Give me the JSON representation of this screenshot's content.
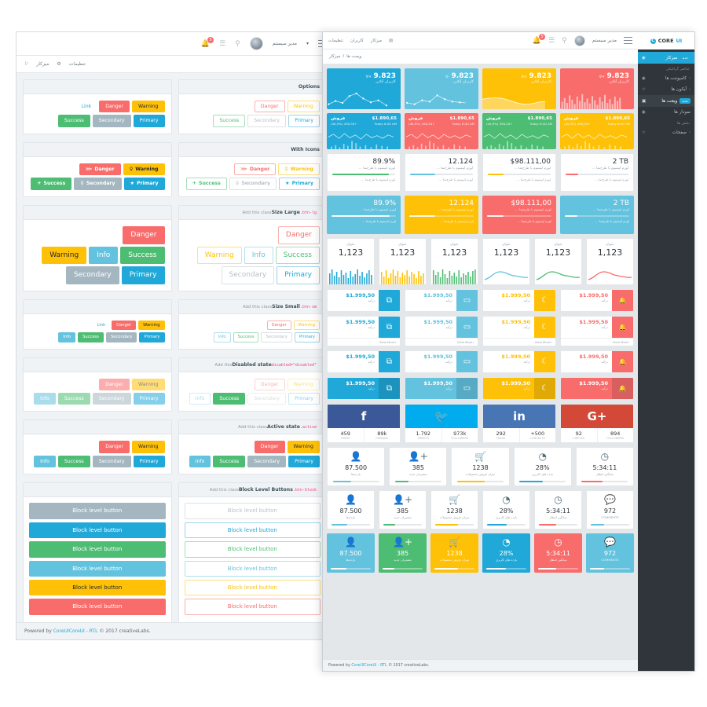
{
  "back_window": {
    "topbar": {
      "user": "مدیر سیستم",
      "caret": "▾",
      "badge_count": "5"
    },
    "breadcrumb": {
      "settings": "تنظیمات",
      "dashboard": "میزکار"
    },
    "footer": {
      "powered": "Powered by",
      "brand": "CoreUICoreUI - RTL",
      "copy": "© 2017 creativeLabs."
    },
    "sections": [
      {
        "title": "Options",
        "code": "",
        "note": "",
        "outline": [
          "Primary",
          "Secondary",
          "Success",
          "Warning",
          "Danger"
        ],
        "solid": [
          "Primary",
          "Secondary",
          "Success",
          "Warning",
          "Danger",
          "Link"
        ]
      },
      {
        "title": "With Icons",
        "code": "",
        "note": "",
        "outline": [
          "Primary",
          "Secondary",
          "Success",
          "Warning",
          "Danger"
        ],
        "solid": [
          "Primary",
          "Secondary",
          "Success",
          "Warning",
          "Danger"
        ]
      },
      {
        "title": "Size Large",
        "code": ".btn-lg",
        "note": "Add this class",
        "outline": [
          "Primary",
          "Secondary",
          "Success",
          "Info",
          "Warning",
          "Danger"
        ],
        "solid": [
          "Primary",
          "Secondary",
          "Success",
          "Info",
          "Warning",
          "Danger"
        ]
      },
      {
        "title": "Size Small",
        "code": ".btn-sm",
        "note": "Add this class",
        "outline": [
          "Primary",
          "Secondary",
          "Success",
          "Info",
          "Warning",
          "Danger"
        ],
        "solid": [
          "Primary",
          "Secondary",
          "Success",
          "Info",
          "Warning",
          "Danger",
          "Link"
        ]
      },
      {
        "title": "Disabled state",
        "code": "disabled=\"disabled\"",
        "note": "Add this",
        "outline": [
          "Primary",
          "Secondary",
          "Success",
          "Info",
          "Warning",
          "Danger"
        ],
        "solid": [
          "Primary",
          "Secondary",
          "Success",
          "Info",
          "Warning",
          "Danger"
        ]
      },
      {
        "title": "Active state",
        "code": ".active",
        "note": "Add this class",
        "outline": [
          "Primary",
          "Secondary",
          "Success",
          "Info",
          "Warning",
          "Danger"
        ],
        "solid": [
          "Primary",
          "Secondary",
          "Success",
          "Info",
          "Warning",
          "Danger"
        ]
      },
      {
        "title": "Block Level Buttons",
        "code": ".btn-block",
        "note": "Add this class",
        "block_label": "Block level button"
      }
    ],
    "icons": {
      "warning": "♀",
      "success": "✈",
      "secondary": "♀",
      "primary": "★",
      "danger": "⋙"
    }
  },
  "front_window": {
    "brand": {
      "mark": "C",
      "name_a": "CORE",
      "name_b": "UI"
    },
    "topnav": [
      "تنظیمات",
      "کاربران",
      "میزکار"
    ],
    "topbar_user": "مدیر سیستم",
    "topbar_badge": "5",
    "breadcrumb": [
      "ویجت ها",
      "/",
      "میزکار"
    ],
    "sidebar": [
      {
        "label": "میزکار",
        "icon": "◉",
        "badge": "جدید",
        "type": "item",
        "state": "active"
      },
      {
        "label": "عناصر گرافیکی",
        "type": "title"
      },
      {
        "label": "کامپوننت ها",
        "icon": "◉",
        "caret": "‹",
        "type": "item"
      },
      {
        "label": "آیکون ها",
        "icon": "☆",
        "caret": "‹",
        "type": "item"
      },
      {
        "label": "ویجت ها",
        "icon": "▣",
        "badge": "جدید",
        "type": "item",
        "state": "sel"
      },
      {
        "label": "نمودار ها",
        "icon": "◉",
        "type": "item"
      },
      {
        "label": "بخش ها",
        "type": "title"
      },
      {
        "label": "صفحات",
        "icon": "☆",
        "caret": "‹",
        "type": "item"
      }
    ],
    "row_online": {
      "value": "9.823",
      "caret": "▾",
      "gear": "⚙",
      "label": "کاربران آنلاین",
      "cards": [
        {
          "color": "#20a8d8",
          "chart": "line"
        },
        {
          "color": "#63c2de",
          "chart": "line"
        },
        {
          "color": "#ffc107",
          "chart": "area"
        },
        {
          "color": "#f86c6b",
          "chart": "bars"
        }
      ]
    },
    "row_sales": {
      "amount": "$1.890,65",
      "label": "فروش",
      "delta": "(40,9%) 490,50+",
      "time": "Today 6:40 AM",
      "cards": [
        {
          "color": "#20a8d8"
        },
        {
          "color": "#f86c6b"
        },
        {
          "color": "#4dbd74"
        },
        {
          "color": "#ffc107"
        }
      ]
    },
    "row_stats": {
      "desc": "لورم ایپسوم یا طرح‌نما …",
      "footer": "لورم ایپسوم یا طرح‌نما …",
      "cards": [
        {
          "value": "89.9%",
          "color": "#4dbd74",
          "pct": 90
        },
        {
          "value": "12.124",
          "color": "#63c2de",
          "pct": 40
        },
        {
          "value": "$98.111,00",
          "color": "#ffc107",
          "pct": 25
        },
        {
          "value": "2 TB",
          "color": "#f86c6b",
          "pct": 20
        }
      ]
    },
    "row_stats_colored": {
      "desc": "لورم ایپسوم یا طرح‌نما …",
      "footer": "لورم ایپسوم یا طرح‌نما …",
      "cards": [
        {
          "value": "89.9%",
          "color": "#63c2de",
          "pct": 90
        },
        {
          "value": "12.124",
          "color": "#ffc107",
          "pct": 40
        },
        {
          "value": "$98.111,00",
          "color": "#f86c6b",
          "pct": 25
        },
        {
          "value": "2 TB",
          "color": "#63c2de",
          "pct": 20
        }
      ]
    },
    "row_charts": {
      "title": "عنوان",
      "value": "1,123",
      "cards": [
        {
          "color": "#20a8d8",
          "chart": "bars"
        },
        {
          "color": "#ffc107",
          "chart": "bars"
        },
        {
          "color": "#4dbd74",
          "chart": "bars"
        },
        {
          "color": "#63c2de",
          "chart": "line"
        },
        {
          "color": "#4dbd74",
          "chart": "line"
        },
        {
          "color": "#f86c6b",
          "chart": "line"
        }
      ]
    },
    "row_icons": {
      "value": "$1.999,50",
      "label": "درآمد",
      "more": "View More!",
      "cards": [
        {
          "color": "#20a8d8",
          "icon": "⧉"
        },
        {
          "color": "#63c2de",
          "icon": "▭"
        },
        {
          "color": "#ffc107",
          "icon": "☾"
        },
        {
          "color": "#f86c6b",
          "icon": "🔔"
        }
      ]
    },
    "social": [
      {
        "net": "facebook",
        "glyph": "f",
        "color": "#3b5998",
        "n1": "89k",
        "l1": "FRIENDS",
        "n2": "459",
        "l2": "FEEDS"
      },
      {
        "net": "twitter",
        "glyph": "🐦",
        "color": "#00aced",
        "n1": "973k",
        "l1": "FOLLOWERS",
        "n2": "1.792",
        "l2": "TWEETS"
      },
      {
        "net": "linkedin",
        "glyph": "in",
        "color": "#4875b4",
        "n1": "+500",
        "l1": "CONTACTS",
        "n2": "292",
        "l2": "FEEDS"
      },
      {
        "net": "google-plus",
        "glyph": "G+",
        "color": "#d34836",
        "n1": "894",
        "l1": "FOLLOWERS",
        "n2": "92",
        "l2": "CIRCLES"
      }
    ],
    "row_bottom_a": [
      {
        "icon": "👤",
        "value": "87.500",
        "label": "بازدیدها",
        "color": "#63c2de",
        "pct": 40
      },
      {
        "icon": "👤+",
        "value": "385",
        "label": "مشتریان جدید",
        "color": "#4dbd74",
        "pct": 30
      },
      {
        "icon": "🛒",
        "value": "1238",
        "label": "میزان فروش محصولات",
        "color": "#ffc107",
        "pct": 60
      },
      {
        "icon": "◔",
        "value": "28%",
        "label": "بازده های کاربری",
        "color": "#20a8d8",
        "pct": 50
      },
      {
        "icon": "◷",
        "value": "5:34:11",
        "label": "میانگین انتظار",
        "color": "#f86c6b",
        "pct": 45
      }
    ],
    "row_bottom_b": [
      {
        "icon": "👤",
        "value": "87.500",
        "label": "بازدیدها",
        "color": "#63c2de",
        "pct": 40
      },
      {
        "icon": "👤+",
        "value": "385",
        "label": "مشتریان جدید",
        "color": "#4dbd74",
        "pct": 30
      },
      {
        "icon": "🛒",
        "value": "1238",
        "label": "میزان فروش محصولات",
        "color": "#ffc107",
        "pct": 60
      },
      {
        "icon": "◔",
        "value": "28%",
        "label": "بازده های کاربری",
        "color": "#20a8d8",
        "pct": 50
      },
      {
        "icon": "◷",
        "value": "5:34:11",
        "label": "میانگین انتظار",
        "color": "#f86c6b",
        "pct": 45
      },
      {
        "icon": "💬",
        "value": "972",
        "label": "COMMENTS",
        "color": "#63c2de",
        "pct": 35
      }
    ],
    "row_bottom_c": [
      {
        "icon": "👤",
        "value": "87.500",
        "label": "بازدیدها",
        "color": "#63c2de",
        "pct": 40
      },
      {
        "icon": "👤+",
        "value": "385",
        "label": "مشتریان جدید",
        "color": "#4dbd74",
        "pct": 30
      },
      {
        "icon": "🛒",
        "value": "1238",
        "label": "میزان فروش محصولات",
        "color": "#ffc107",
        "pct": 60
      },
      {
        "icon": "◔",
        "value": "28%",
        "label": "بازده های کاربری",
        "color": "#20a8d8",
        "pct": 50
      },
      {
        "icon": "◷",
        "value": "5:34:11",
        "label": "میانگین انتظار",
        "color": "#f86c6b",
        "pct": 45
      },
      {
        "icon": "💬",
        "value": "972",
        "label": "COMMENTS",
        "color": "#63c2de",
        "pct": 35
      }
    ],
    "footer": {
      "powered": "Powered by",
      "brand": "CoreUICoreUI - RTL",
      "copy": "© 2017 creativeLabs."
    }
  }
}
